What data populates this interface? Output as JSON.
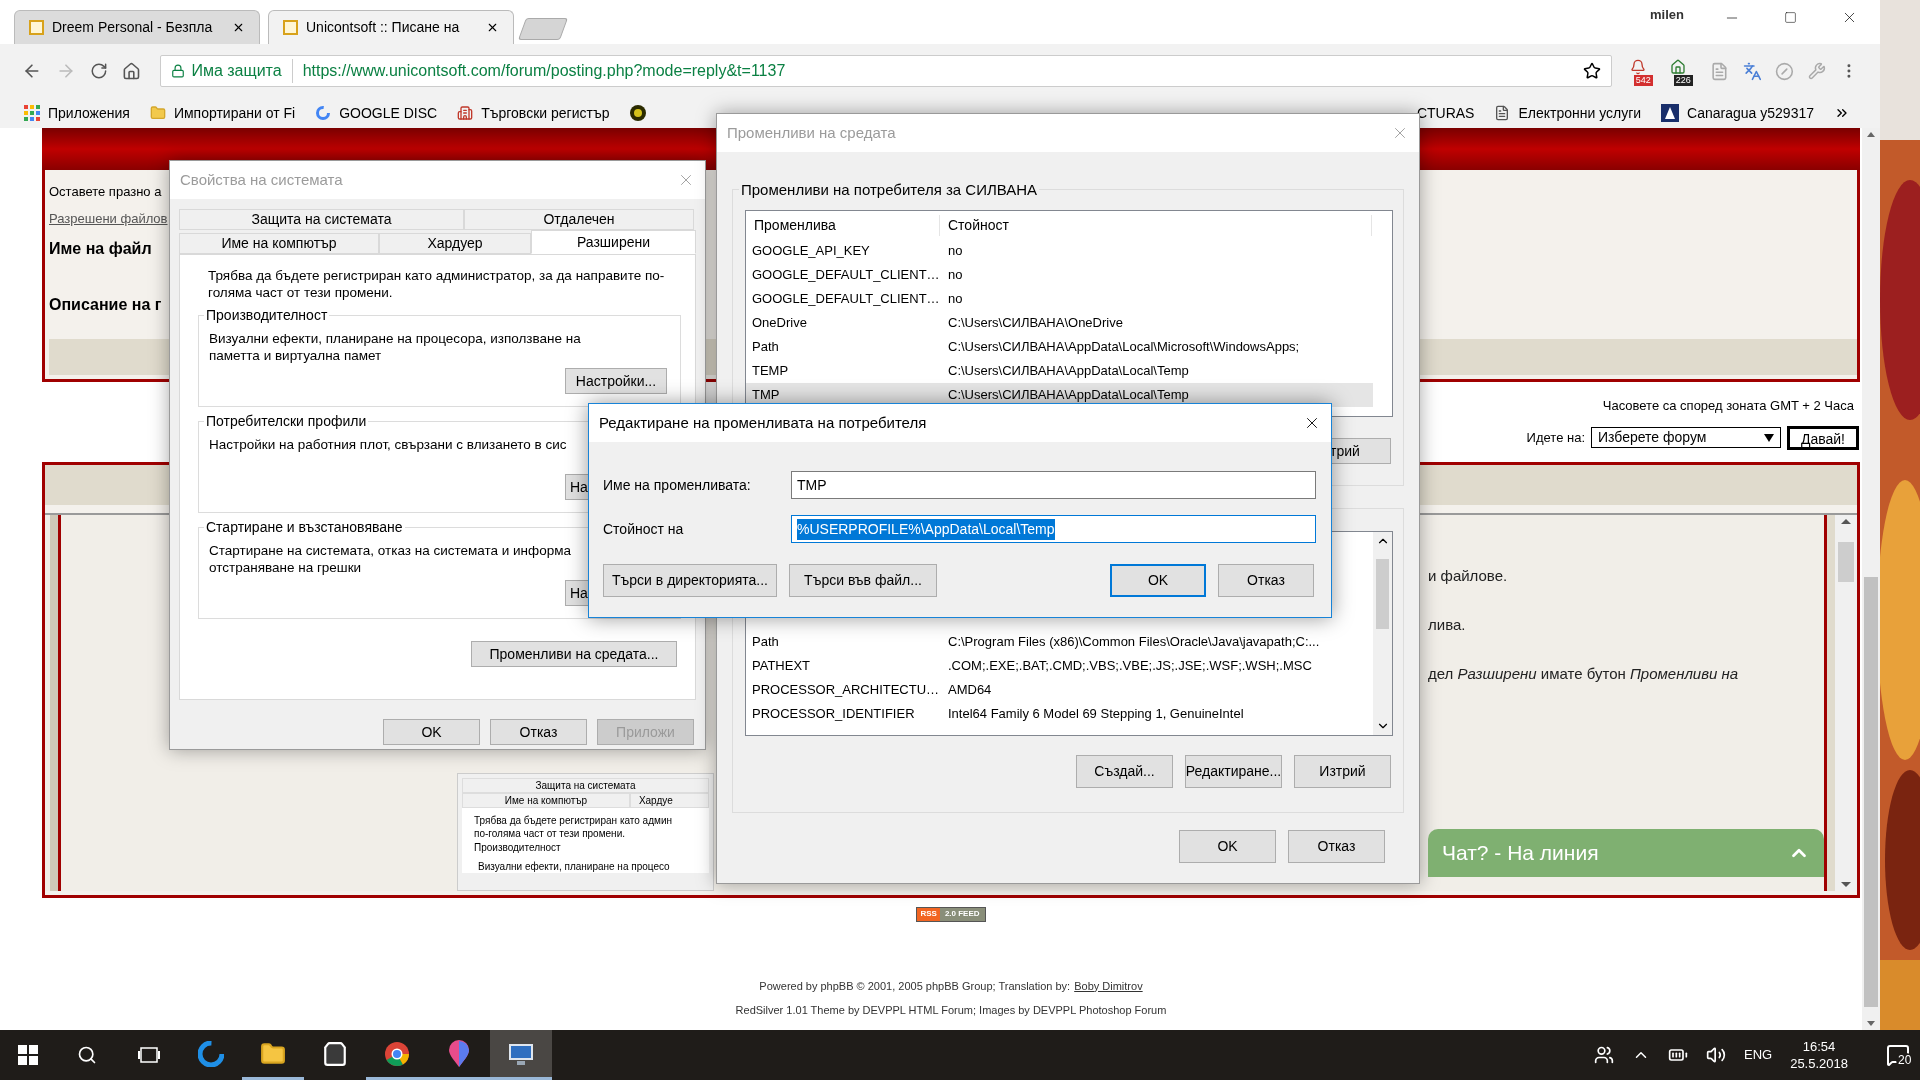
{
  "browser": {
    "user": "milen",
    "tabs": [
      {
        "title": "Dreem Personal - Безпла",
        "selected": false
      },
      {
        "title": "Unicontsoft :: Писане на",
        "selected": true
      }
    ],
    "security": "Има защита",
    "url": "https://www.unicontsoft.com/forum/posting.php?mode=reply&t=1137",
    "extension_badges": [
      "542",
      "226"
    ],
    "bookmarks": [
      {
        "kind": "apps",
        "label": "Приложения"
      },
      {
        "kind": "folder",
        "label": "Импортирани от Fi"
      },
      {
        "kind": "ring",
        "label": "GOOGLE DISC"
      },
      {
        "kind": "building",
        "label": "Търговски регистър"
      },
      {
        "kind": "badge"
      }
    ],
    "bookmarks_right": [
      {
        "kind": "plain",
        "label": "CTURAS"
      },
      {
        "kind": "document",
        "label": "Електронни услуги"
      },
      {
        "kind": "logo",
        "label": "Canaragua y529317"
      }
    ]
  },
  "forum": {
    "hint": "Оставете празно а",
    "allowed_link": "Разрешени файлов",
    "file_label": "Име на файл",
    "desc_label": "Описание на г",
    "timezone": "Часовете са според зоната GMT + 2 Часа",
    "jump_label": "Идете на:",
    "jump_select": "Изберете форум",
    "jump_button": "Давай!",
    "post_lines": [
      "и файлове.",
      "лива.",
      "дел *Разширени* имате бутон *Променливи на*"
    ],
    "embedded_screenshot": {
      "tab_top": "Защита на системата",
      "tabs": [
        "Име на компютър",
        "Хардуе"
      ],
      "note": [
        "Трябва да бъдете регистриран като админ",
        "по-голяма част от тези промени."
      ],
      "group": "Производителност",
      "group_text": "Визуални ефекти, планиране на процесо"
    },
    "rss": [
      "RSS",
      "2.0 FEED"
    ],
    "footer": {
      "powered": "Powered by phpBB © 2001, 2005 phpBB Group; Translation by:",
      "translator": "Boby Dimitrov",
      "theme": "RedSilver 1.01 Theme by DEVPPL HTML Forum; Images by DEVPPL Photoshop Forum"
    },
    "chat": {
      "label": "Чат? - На линия",
      "expanded": false
    }
  },
  "system_properties": {
    "title": "Свойства на системата",
    "tabs_top": [
      {
        "label": "Защита на системата",
        "selected": false
      },
      {
        "label": "Отдалечен",
        "selected": false
      }
    ],
    "tabs": [
      {
        "label": "Име на компютър",
        "selected": false
      },
      {
        "label": "Хардуер",
        "selected": false
      },
      {
        "label": "Разширени",
        "selected": true
      }
    ],
    "note": "Трябва да бъдете регистриран като администратор, за да направите по-голяма част от тези промени.",
    "groups": [
      {
        "title": "Производителност",
        "text": "Визуални ефекти, планиране на процесора, използване на паметта и виртуална памет",
        "button": "Настройки..."
      },
      {
        "title": "Потребителски профили",
        "text": "Настройки на работния плот, свързани с влизането в сис",
        "button": "На"
      },
      {
        "title": "Стартиране и възстановяване",
        "text": "Стартиране на системата, отказ на системата и информа отстраняване на грешки",
        "button": "На"
      }
    ],
    "env_button": "Променливи на средата...",
    "buttons": [
      {
        "label": "OK",
        "disabled": false
      },
      {
        "label": "Отказ",
        "disabled": false
      },
      {
        "label": "Приложи",
        "disabled": true
      }
    ]
  },
  "env_vars": {
    "title": "Променливи на средата",
    "user_group": "Променливи на потребителя за СИЛВАНА",
    "columns": [
      "Променлива",
      "Стойност"
    ],
    "user_rows": [
      {
        "name": "GOOGLE_API_KEY",
        "value": "no",
        "selected": false
      },
      {
        "name": "GOOGLE_DEFAULT_CLIENT…",
        "value": "no",
        "selected": false
      },
      {
        "name": "GOOGLE_DEFAULT_CLIENT…",
        "value": "no",
        "selected": false
      },
      {
        "name": "OneDrive",
        "value": "C:\\Users\\СИЛВАНА\\OneDrive",
        "selected": false
      },
      {
        "name": "Path",
        "value": "C:\\Users\\СИЛВАНА\\AppData\\Local\\Microsoft\\WindowsApps;",
        "selected": false
      },
      {
        "name": "TEMP",
        "value": "C:\\Users\\СИЛВАНА\\AppData\\Local\\Temp",
        "selected": false
      },
      {
        "name": "TMP",
        "value": "C:\\Users\\СИЛВАНА\\AppData\\Local\\Temp",
        "selected": true
      }
    ],
    "user_delete": "трий",
    "system_rows": [
      {
        "name": "Path",
        "value": "C:\\Program Files (x86)\\Common Files\\Oracle\\Java\\javapath;C:..."
      },
      {
        "name": "PATHEXT",
        "value": ".COM;.EXE;.BAT;.CMD;.VBS;.VBE;.JS;.JSE;.WSF;.WSH;.MSC"
      },
      {
        "name": "PROCESSOR_ARCHITECTU…",
        "value": "AMD64"
      },
      {
        "name": "PROCESSOR_IDENTIFIER",
        "value": "Intel64 Family 6 Model 69 Stepping 1, GenuineIntel"
      }
    ],
    "system_buttons": [
      "Създай...",
      "Редактиране...",
      "Изтрий"
    ],
    "buttons": [
      "OK",
      "Отказ"
    ]
  },
  "edit_dialog": {
    "title": "Редактиране на променливата на потребителя",
    "fields": [
      {
        "label": "Име на променливата:",
        "value": "TMP",
        "text_selected": false
      },
      {
        "label": "Стойност на",
        "value": "%USERPROFILE%\\AppData\\Local\\Temp",
        "text_selected": true
      }
    ],
    "browse_buttons": [
      "Търси в директорията...",
      "Търси във файл..."
    ],
    "buttons": [
      {
        "label": "OK",
        "default": true
      },
      {
        "label": "Отказ",
        "default": false
      }
    ]
  },
  "taskbar": {
    "apps": [
      {
        "kind": "swirl",
        "running": false,
        "active": false
      },
      {
        "kind": "folder",
        "running": true,
        "active": false
      },
      {
        "kind": "store",
        "running": false,
        "active": false
      },
      {
        "kind": "circle",
        "running": true,
        "active": false
      },
      {
        "kind": "balloon",
        "running": true,
        "active": false
      },
      {
        "kind": "monitor",
        "running": true,
        "active": true
      }
    ],
    "language": "ENG",
    "time": "16:54",
    "date": "25.5.2018",
    "notifications": "20"
  }
}
